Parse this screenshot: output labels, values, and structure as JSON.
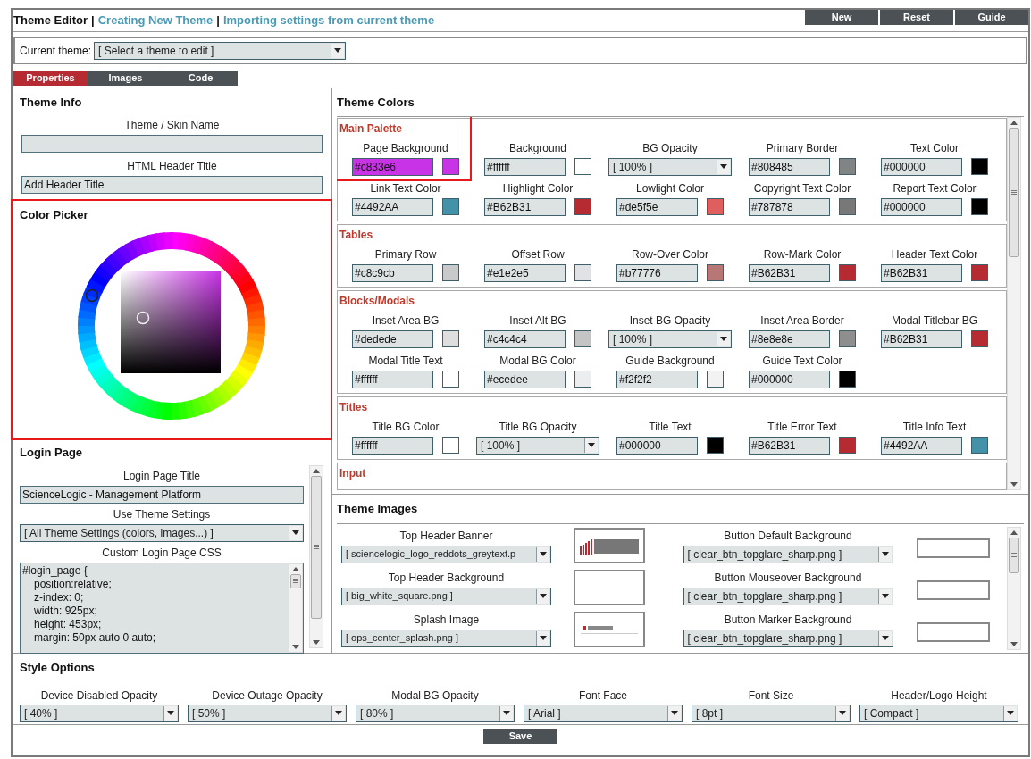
{
  "header": {
    "title": "Theme Editor",
    "separator": "|",
    "links": [
      "Creating New Theme",
      "Importing settings from current theme"
    ],
    "buttons": [
      "New",
      "Reset",
      "Guide"
    ]
  },
  "current_theme": {
    "label": "Current theme:",
    "value": "[ Select a theme to edit ]"
  },
  "tabs": [
    {
      "label": "Properties",
      "selected": true
    },
    {
      "label": "Images",
      "selected": false
    },
    {
      "label": "Code",
      "selected": false
    }
  ],
  "theme_info": {
    "title": "Theme Info",
    "fields": [
      {
        "label": "Theme / Skin Name"
      },
      {
        "label": "HTML Header Title",
        "value": "Add Header Title"
      }
    ]
  },
  "color_picker": {
    "title": "Color Picker",
    "highlighted": true
  },
  "login_page": {
    "title": "Login Page",
    "fields": [
      {
        "kind": "text",
        "label": "Login Page Title",
        "value": "ScienceLogic - Management Platform"
      },
      {
        "kind": "select",
        "label": "Use Theme Settings",
        "value": "[ All Theme Settings (colors, images...) ]"
      },
      {
        "kind": "code",
        "label": "Custom Login Page CSS",
        "selector": "#login_page {",
        "declarations": [
          "position:relative;",
          "z-index: 0;",
          "width: 925px;",
          "height: 453px;",
          "margin: 50px auto 0 auto;"
        ]
      }
    ]
  },
  "theme_colors": {
    "title": "Theme Colors",
    "groups": [
      {
        "title": "Main Palette",
        "highlighted": true,
        "fields": [
          {
            "kind": "color",
            "label": "Page Background",
            "value": "#c833e6",
            "color": "#c833e6",
            "selected": true
          },
          {
            "kind": "color",
            "label": "Background",
            "value": "#ffffff",
            "color": "#ffffff",
            "selected": false
          },
          {
            "kind": "select",
            "label": "BG Opacity",
            "value": "[ 100% ]"
          },
          {
            "kind": "color",
            "label": "Primary Border",
            "value": "#808485",
            "color": "#808485",
            "selected": false
          },
          {
            "kind": "color",
            "label": "Text Color",
            "value": "#000000",
            "color": "#000000",
            "selected": false
          },
          {
            "kind": "color",
            "label": "Link Text Color",
            "value": "#4492AA",
            "color": "#4492aa",
            "selected": false
          },
          {
            "kind": "color",
            "label": "Highlight Color",
            "value": "#B62B31",
            "color": "#b62b31",
            "selected": false
          },
          {
            "kind": "color",
            "label": "Lowlight Color",
            "value": "#de5f5e",
            "color": "#de5f5e",
            "selected": false
          },
          {
            "kind": "color",
            "label": "Copyright Text Color",
            "value": "#787878",
            "color": "#787878",
            "selected": false
          },
          {
            "kind": "color",
            "label": "Report Text Color",
            "value": "#000000",
            "color": "#000000",
            "selected": false
          }
        ]
      },
      {
        "title": "Tables",
        "highlighted": false,
        "fields": [
          {
            "kind": "color",
            "label": "Primary Row",
            "value": "#c8c9cb",
            "color": "#c8c9cb",
            "selected": false
          },
          {
            "kind": "color",
            "label": "Offset Row",
            "value": "#e1e2e5",
            "color": "#e1e2e5",
            "selected": false
          },
          {
            "kind": "color",
            "label": "Row-Over Color",
            "value": "#b77776",
            "color": "#b77776",
            "selected": false
          },
          {
            "kind": "color",
            "label": "Row-Mark Color",
            "value": "#B62B31",
            "color": "#b62b31",
            "selected": false
          },
          {
            "kind": "color",
            "label": "Header Text Color",
            "value": "#B62B31",
            "color": "#b62b31",
            "selected": false
          }
        ]
      },
      {
        "title": "Blocks/Modals",
        "highlighted": false,
        "fields": [
          {
            "kind": "color",
            "label": "Inset Area BG",
            "value": "#dedede",
            "color": "#dedede",
            "selected": false
          },
          {
            "kind": "color",
            "label": "Inset Alt BG",
            "value": "#c4c4c4",
            "color": "#c4c4c4",
            "selected": false
          },
          {
            "kind": "select",
            "label": "Inset BG Opacity",
            "value": "[ 100% ]"
          },
          {
            "kind": "color",
            "label": "Inset Area Border",
            "value": "#8e8e8e",
            "color": "#8e8e8e",
            "selected": false
          },
          {
            "kind": "color",
            "label": "Modal Titlebar BG",
            "value": "#B62B31",
            "color": "#b62b31",
            "selected": false
          },
          {
            "kind": "color",
            "label": "Modal Title Text",
            "value": "#ffffff",
            "color": "#ffffff",
            "selected": false
          },
          {
            "kind": "color",
            "label": "Modal BG Color",
            "value": "#ecedee",
            "color": "#ecedee",
            "selected": false
          },
          {
            "kind": "color",
            "label": "Guide Background",
            "value": "#f2f2f2",
            "color": "#f2f2f2",
            "selected": false
          },
          {
            "kind": "color",
            "label": "Guide Text Color",
            "value": "#000000",
            "color": "#000000",
            "selected": false
          }
        ]
      },
      {
        "title": "Titles",
        "highlighted": false,
        "fields": [
          {
            "kind": "color",
            "label": "Title BG Color",
            "value": "#ffffff",
            "color": "#ffffff",
            "selected": false
          },
          {
            "kind": "select",
            "label": "Title BG Opacity",
            "value": "[ 100% ]"
          },
          {
            "kind": "color",
            "label": "Title Text",
            "value": "#000000",
            "color": "#000000",
            "selected": false
          },
          {
            "kind": "color",
            "label": "Title Error Text",
            "value": "#B62B31",
            "color": "#b62b31",
            "selected": false
          },
          {
            "kind": "color",
            "label": "Title Info Text",
            "value": "#4492AA",
            "color": "#4492aa",
            "selected": false
          }
        ]
      },
      {
        "title": "Input",
        "highlighted": false
      }
    ]
  },
  "theme_images": {
    "title": "Theme Images",
    "rows": [
      {
        "label": "Top Header Banner",
        "value": "[ sciencelogic_logo_reddots_greytext.p",
        "kind": "logo",
        "button_label": "Button Default Background",
        "button_value": "[ clear_btn_topglare_sharp.png ]"
      },
      {
        "label": "Top Header Background",
        "value": "[ big_white_square.png ]",
        "kind": "blank",
        "button_label": "Button Mouseover Background",
        "button_value": "[ clear_btn_topglare_sharp.png ]"
      },
      {
        "label": "Splash Image",
        "value": "[ ops_center_splash.png ]",
        "kind": "splash",
        "button_label": "Button Marker Background",
        "button_value": "[ clear_btn_topglare_sharp.png ]"
      }
    ]
  },
  "style_options": {
    "title": "Style Options",
    "fields": [
      {
        "label": "Device Disabled Opacity",
        "value": "[ 40% ]"
      },
      {
        "label": "Device Outage Opacity",
        "value": "[ 50% ]"
      },
      {
        "label": "Modal BG Opacity",
        "value": "[ 80% ]"
      },
      {
        "label": "Font Face",
        "value": "[ Arial ]"
      },
      {
        "label": "Font Size",
        "value": "[ 8pt ]"
      },
      {
        "label": "Header/Logo Height",
        "value": "[ Compact ]"
      }
    ]
  },
  "save_button": "Save"
}
